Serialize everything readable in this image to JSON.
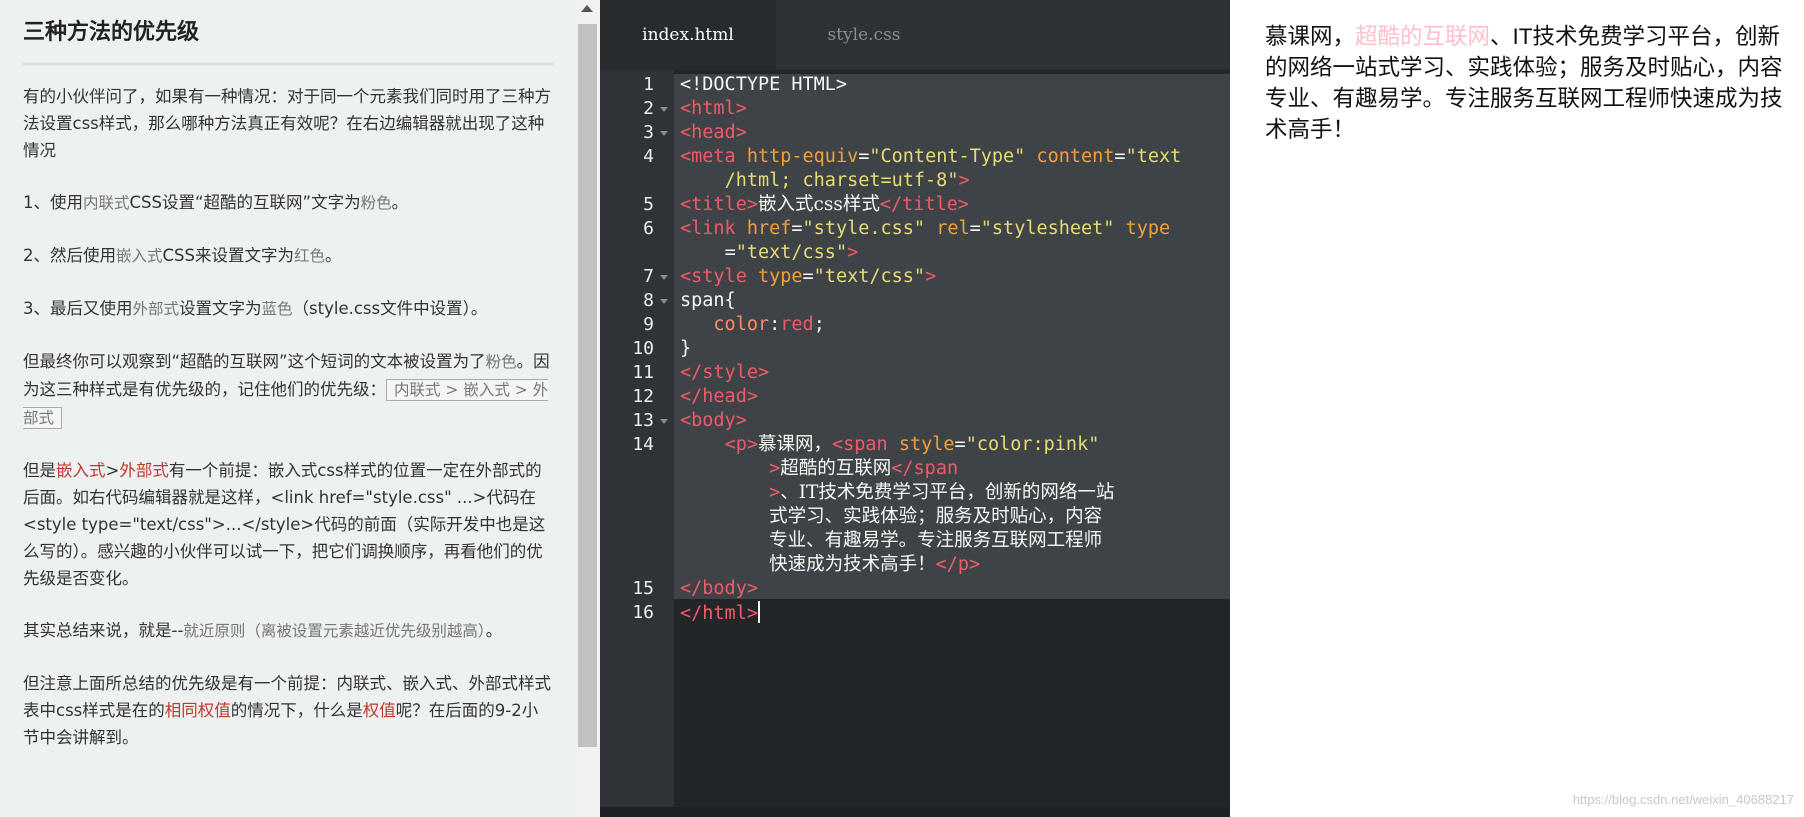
{
  "lesson": {
    "title": "三种方法的优先级",
    "p1": "有的小伙伴问了，如果有一种情况：对于同一个元素我们同时用了三种方法设置css样式，那么哪种方法真正有效呢？在右边编辑器就出现了这种情况",
    "p2": {
      "prefix": "1、使用",
      "term": "内联式",
      "mid": "CSS设置“超酷的互联网”文字为",
      "color": "粉色",
      "suffix": "。"
    },
    "p3": {
      "prefix": "2、然后使用",
      "term": "嵌入式",
      "mid": "CSS来设置文字为",
      "color": "红色",
      "suffix": "。"
    },
    "p4": {
      "prefix": "3、最后又使用",
      "term": "外部式",
      "mid": "设置文字为",
      "color": "蓝色",
      "suffix": "（style.css文件中设置）。"
    },
    "p5": {
      "prefix": "但最终你可以观察到“超酷的互联网”这个短词的文本被设置为了",
      "color": "粉色",
      "mid": "。因为这三种样式是有优先级的，记住他们的优先级：",
      "box": "内联式 > 嵌入式 > 外部式"
    },
    "p6": {
      "prefix": "但是",
      "a": "嵌入式",
      "gt": ">",
      "b": "外部式",
      "rest": "有一个前提：嵌入式css样式的位置一定在外部式的后面。如右代码编辑器就是这样，<link href=\"style.css\" ...>代码在<style type=\"text/css\">...</style>代码的前面（实际开发中也是这么写的）。感兴趣的小伙伴可以试一下，把它们调换顺序，再看他们的优先级是否变化。"
    },
    "p7": {
      "prefix": "其实总结来说，就是--",
      "serif": "就近原则（离被设置元素越近优先级别越高）",
      "suffix": "。"
    },
    "p8": {
      "prefix": "但注意上面所总结的优先级是有一个前提：内联式、嵌入式、外部式样式表中css样式是在的",
      "a": "相同权值",
      "mid": "的情况下，什么是",
      "b": "权值",
      "suffix": "呢？在后面的9-2小节中会讲解到。"
    }
  },
  "editor": {
    "tabs": [
      "index.html",
      "style.css"
    ],
    "line_numbers": [
      "1",
      "2",
      "3",
      "4",
      "5",
      "6",
      "7",
      "8",
      "9",
      "10",
      "11",
      "12",
      "13",
      "14",
      "15",
      "16"
    ],
    "l1": "<!DOCTYPE HTML>",
    "l2": "<html>",
    "l3": "<head>",
    "l4a": {
      "tag": "<meta",
      "attr1": "http-equiv",
      "eq1": "=",
      "val1": "\"Content-Type\"",
      "attr2": "content",
      "eq2": "=",
      "val2a": "\"text"
    },
    "l4b": {
      "val2b": "/html; charset=utf-8\"",
      "close": ">"
    },
    "l5": {
      "open": "<title>",
      "text": "嵌入式css样式",
      "close": "</title>"
    },
    "l6a": {
      "tag": "<link",
      "attr1": "href",
      "eq1": "=",
      "val1": "\"style.css\"",
      "attr2": "rel",
      "eq2": "=",
      "val2": "\"stylesheet\"",
      "attr3": "type"
    },
    "l6b": {
      "eq3": "=",
      "val3": "\"text/css\"",
      "close": ">"
    },
    "l7": {
      "tag": "<style",
      "attr": "type",
      "eq": "=",
      "val": "\"text/css\"",
      "close": ">"
    },
    "l8": "span{",
    "l9": {
      "prop": "color",
      "colon": ":",
      "value": "red",
      "semi": ";"
    },
    "l10": "}",
    "l11": "</style>",
    "l12": "</head>",
    "l13": "<body>",
    "l14a": {
      "p": "<p>",
      "text": "慕课网，",
      "tag": "<span",
      "attr": "style",
      "eq": "=",
      "val": "\"color:pink\""
    },
    "l14b": {
      "close": ">",
      "text": "超酷的互联网",
      "tag": "</span"
    },
    "l14c": {
      "close": ">",
      "text": "、IT技术免费学习平台，创新的网络一站"
    },
    "l14d": "式学习、实践体验；服务及时贴心，内容",
    "l14e": "专业、有趣易学。专注服务互联网工程师",
    "l14f": {
      "text": "快速成为技术高手！",
      "close": "</p>"
    },
    "l15": "</body>",
    "l16": "</html>"
  },
  "preview": {
    "before": "慕课网，",
    "pink": "超酷的互联网",
    "after": "、IT技术免费学习平台，创新的网络一站式学习、实践体验；服务及时贴心，内容专业、有趣易学。专注服务互联网工程师快速成为技术高手！",
    "watermark": "https://blog.csdn.net/weixin_40688217"
  }
}
